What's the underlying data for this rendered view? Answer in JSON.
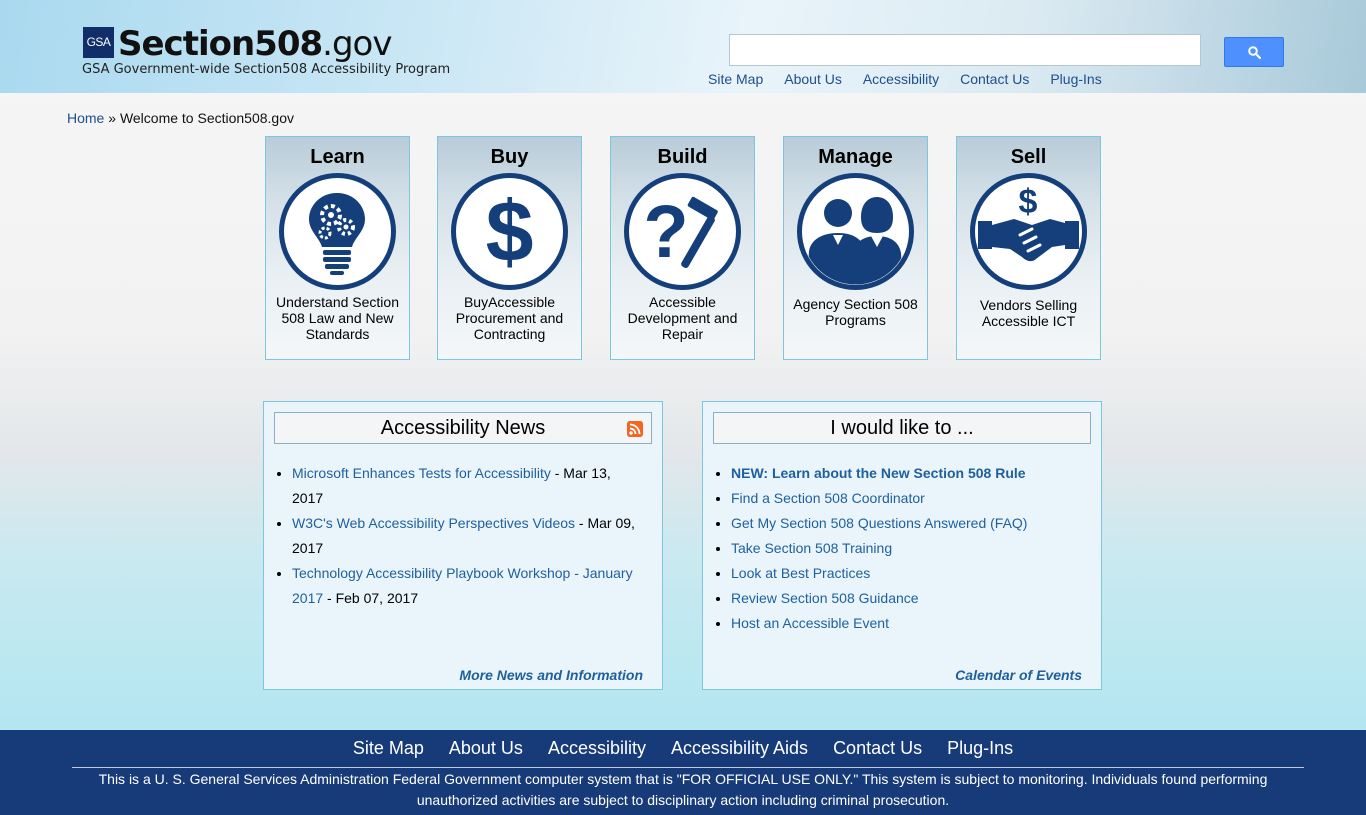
{
  "header": {
    "logo_badge": "GSA",
    "title_bold": "Section508",
    "title_suffix": ".gov",
    "subtitle": "GSA Government-wide Section508 Accessibility Program",
    "search": {
      "placeholder": "",
      "value": ""
    },
    "top_nav": [
      "Site Map",
      "About Us",
      "Accessibility",
      "Contact Us",
      "Plug-Ins"
    ]
  },
  "breadcrumb": {
    "home": "Home",
    "separator": "»",
    "current": "Welcome to Section508.gov"
  },
  "tiles": [
    {
      "title": "Learn",
      "icon": "lightbulb-gears-icon",
      "description": "Understand Section 508 Law and New Standards"
    },
    {
      "title": "Buy",
      "icon": "dollar-sign-icon",
      "description": "BuyAccessible Procurement and Contracting"
    },
    {
      "title": "Build",
      "icon": "question-hammer-icon",
      "description": "Accessible Development and Repair"
    },
    {
      "title": "Manage",
      "icon": "people-icon",
      "description": "Agency Section 508 Programs"
    },
    {
      "title": "Sell",
      "icon": "handshake-dollar-icon",
      "description": "Vendors Selling Accessible ICT"
    }
  ],
  "news": {
    "title": "Accessibility News",
    "items": [
      {
        "link": "Microsoft Enhances Tests for Accessibility",
        "date": " - Mar 13, 2017"
      },
      {
        "link": "W3C's Web Accessibility Perspectives Videos",
        "date": " - Mar 09, 2017"
      },
      {
        "link": "Technology Accessibility Playbook Workshop - January 2017",
        "date": " - Feb 07, 2017"
      }
    ],
    "more": "More News and Information"
  },
  "actions": {
    "title": "I would like to ...",
    "items": [
      "NEW: Learn about the New Section 508 Rule",
      "Find a Section 508 Coordinator",
      "Get My Section 508 Questions Answered (FAQ)",
      "Take Section 508 Training",
      "Look at Best Practices",
      "Review Section 508 Guidance",
      "Host an Accessible Event"
    ],
    "more": "Calendar of Events"
  },
  "footer": {
    "nav": [
      "Site Map",
      "About Us",
      "Accessibility",
      "Accessibility Aids",
      "Contact Us",
      "Plug-Ins"
    ],
    "notice": "This is a U. S. General Services Administration Federal Government computer system that is \"FOR OFFICIAL USE ONLY.\" This system is subject to monitoring. Individuals found performing unauthorized activities are subject to disciplinary action including criminal prosecution."
  },
  "colors": {
    "navy": "#143f7a",
    "link": "#1f5f9e",
    "footer_bg": "#173a78",
    "search_button": "#4d90fe",
    "tile_border": "#7cc6e0"
  }
}
